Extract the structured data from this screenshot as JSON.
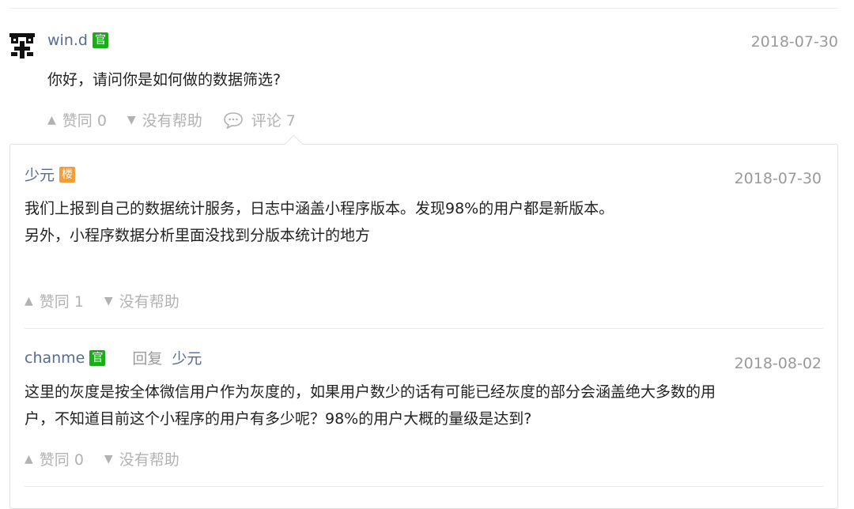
{
  "question": {
    "username": "win.d",
    "badge": "官",
    "date": "2018-07-30",
    "text": "你好，请问你是如何做的数据筛选?",
    "upvote_label": "赞同 0",
    "unhelpful_label": "没有帮助",
    "comment_label": "评论 7"
  },
  "comments": [
    {
      "username": "少元",
      "badge": "楼",
      "date": "2018-07-30",
      "text_line1": "我们上报到自己的数据统计服务，日志中涵盖小程序版本。发现98%的用户都是新版本。",
      "text_line2": "另外，小程序数据分析里面没找到分版本统计的地方",
      "upvote_label": "赞同 1",
      "unhelpful_label": "没有帮助"
    },
    {
      "username": "chanme",
      "badge": "官",
      "reply_word": "回复",
      "reply_to": "少元",
      "date": "2018-08-02",
      "text_line1": "这里的灰度是按全体微信用户作为灰度的，如果用户数少的话有可能已经灰度的部分会涵盖绝大多数的用",
      "text_line2": "户，不知道目前这个小程序的用户有多少呢？98%的用户大概的量级是达到?",
      "upvote_label": "赞同 0",
      "unhelpful_label": "没有帮助"
    }
  ],
  "colors": {
    "link": "#576b95",
    "official_badge": "#1aad19",
    "floor_badge": "#f29d38",
    "muted": "#b2b2b2"
  },
  "icons": {
    "avatar": "avatar-icon",
    "upvote": "triangle-up-icon",
    "downvote": "triangle-down-icon",
    "comment": "comment-bubble-icon"
  }
}
